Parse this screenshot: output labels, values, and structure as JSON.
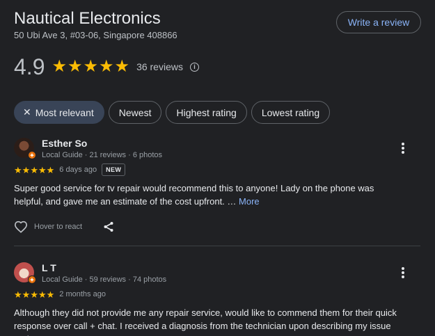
{
  "business": {
    "name": "Nautical Electronics",
    "address": "50 Ubi Ave 3, #03-06, Singapore 408866",
    "write_review_label": "Write a review"
  },
  "summary": {
    "rating": "4.9",
    "stars_filled": 5,
    "review_count": "36 reviews",
    "info_icon": "info-icon"
  },
  "filters": [
    {
      "label": "Most relevant",
      "active": true
    },
    {
      "label": "Newest",
      "active": false
    },
    {
      "label": "Highest rating",
      "active": false
    },
    {
      "label": "Lowest rating",
      "active": false
    }
  ],
  "reviews": [
    {
      "name": "Esther So",
      "subtitle": "Local Guide · 21 reviews · 6 photos",
      "stars": 5,
      "date": "6 days ago",
      "badge": "NEW",
      "text": "Super good service for tv repair would recommend this to anyone! Lady on the phone was helpful, and gave me an estimate of the cost upfront. …",
      "more_label": "More",
      "react_label": "Hover to react"
    },
    {
      "name": "L T",
      "subtitle": "Local Guide · 59 reviews · 74 photos",
      "stars": 5,
      "date": "2 months ago",
      "text": "Although they did not provide me any repair service, would like to commend them for their quick response over call + chat. I received a diagnosis from the technician upon describing my issue and"
    }
  ],
  "colors": {
    "background": "#202124",
    "star": "#fbbc04",
    "link": "#8ab4f8",
    "chip_active": "#394457"
  }
}
